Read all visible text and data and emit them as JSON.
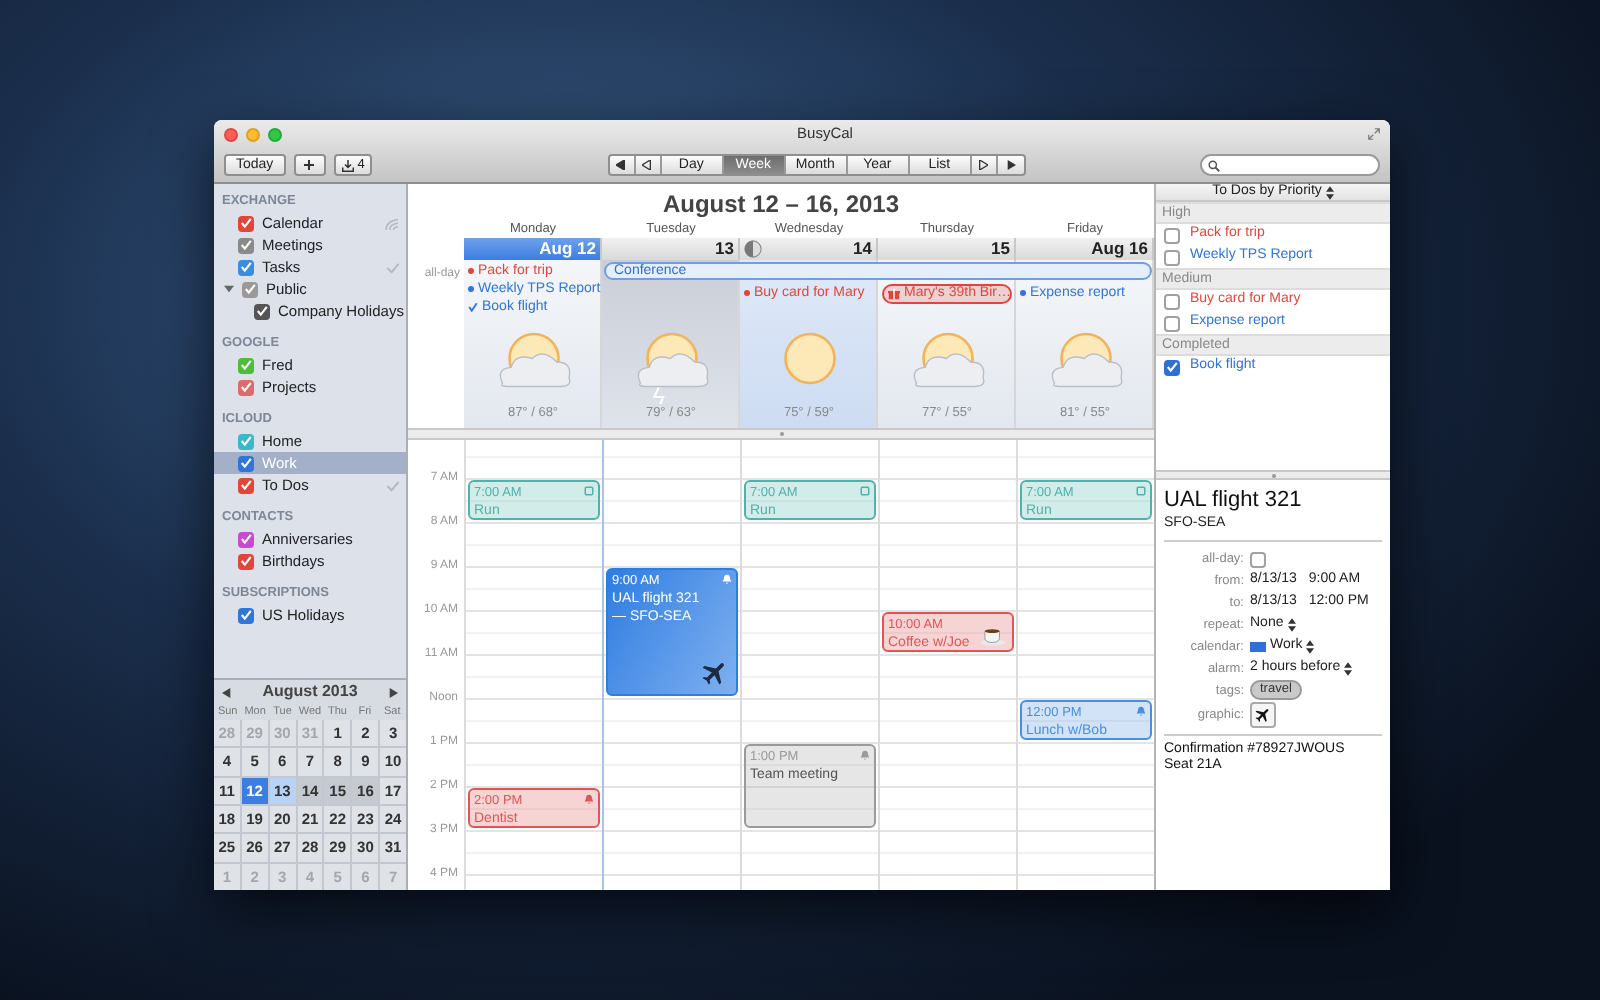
{
  "window": {
    "title": "BusyCal"
  },
  "toolbar": {
    "today": "Today",
    "downloads": "4",
    "views": [
      {
        "label": "Day",
        "selected": false
      },
      {
        "label": "Week",
        "selected": true
      },
      {
        "label": "Month",
        "selected": false
      },
      {
        "label": "Year",
        "selected": false
      },
      {
        "label": "List",
        "selected": false
      }
    ]
  },
  "sidebar": {
    "groups": [
      {
        "title": "EXCHANGE",
        "items": [
          {
            "label": "Calendar",
            "color": "#e2463a",
            "checked": true,
            "selected": false,
            "kind": "shared"
          },
          {
            "label": "Meetings",
            "color": "#8a8a8a",
            "checked": true,
            "selected": false,
            "kind": "plain"
          },
          {
            "label": "Tasks",
            "color": "#3a8ee0",
            "checked": true,
            "selected": false,
            "kind": "tasks"
          },
          {
            "label": "Public",
            "color": "#9a9a9a",
            "checked": true,
            "selected": false,
            "kind": "plain",
            "expanded": true,
            "children": [
              {
                "label": "Company Holidays",
                "color": "#555555",
                "checked": true,
                "selected": false
              }
            ]
          }
        ]
      },
      {
        "title": "GOOGLE",
        "items": [
          {
            "label": "Fred",
            "color": "#4cbc3a",
            "checked": true,
            "selected": false,
            "kind": "plain"
          },
          {
            "label": "Projects",
            "color": "#e06a6a",
            "checked": true,
            "selected": false,
            "kind": "plain"
          }
        ]
      },
      {
        "title": "ICLOUD",
        "items": [
          {
            "label": "Home",
            "color": "#3ab8c8",
            "checked": true,
            "selected": false,
            "kind": "plain"
          },
          {
            "label": "Work",
            "color": "#2f76d8",
            "checked": true,
            "selected": true,
            "kind": "plain"
          },
          {
            "label": "To Dos",
            "color": "#e2463a",
            "checked": true,
            "selected": false,
            "kind": "tasks"
          }
        ]
      },
      {
        "title": "CONTACTS",
        "items": [
          {
            "label": "Anniversaries",
            "color": "#c84ad0",
            "checked": true,
            "selected": false,
            "kind": "plain"
          },
          {
            "label": "Birthdays",
            "color": "#e2463a",
            "checked": true,
            "selected": false,
            "kind": "plain"
          }
        ]
      },
      {
        "title": "SUBSCRIPTIONS",
        "items": [
          {
            "label": "US Holidays",
            "color": "#2f76d8",
            "checked": true,
            "selected": false,
            "kind": "plain"
          }
        ]
      }
    ]
  },
  "mini_calendar": {
    "title": "August 2013",
    "weekdays": [
      "Sun",
      "Mon",
      "Tue",
      "Wed",
      "Thu",
      "Fri",
      "Sat"
    ],
    "weeks": [
      [
        {
          "day": "28",
          "kind": "outside"
        },
        {
          "day": "29",
          "kind": "outside"
        },
        {
          "day": "30",
          "kind": "outside"
        },
        {
          "day": "31",
          "kind": "outside"
        },
        {
          "day": "1",
          "kind": "normal"
        },
        {
          "day": "2",
          "kind": "normal"
        },
        {
          "day": "3",
          "kind": "normal"
        }
      ],
      [
        {
          "day": "4",
          "kind": "normal"
        },
        {
          "day": "5",
          "kind": "normal"
        },
        {
          "day": "6",
          "kind": "normal"
        },
        {
          "day": "7",
          "kind": "normal"
        },
        {
          "day": "8",
          "kind": "normal"
        },
        {
          "day": "9",
          "kind": "normal"
        },
        {
          "day": "10",
          "kind": "normal"
        }
      ],
      [
        {
          "day": "11",
          "kind": "normal"
        },
        {
          "day": "12",
          "kind": "selected"
        },
        {
          "day": "13",
          "kind": "today"
        },
        {
          "day": "14",
          "kind": "week"
        },
        {
          "day": "15",
          "kind": "week"
        },
        {
          "day": "16",
          "kind": "week"
        },
        {
          "day": "17",
          "kind": "normal"
        }
      ],
      [
        {
          "day": "18",
          "kind": "normal"
        },
        {
          "day": "19",
          "kind": "normal"
        },
        {
          "day": "20",
          "kind": "normal"
        },
        {
          "day": "21",
          "kind": "normal"
        },
        {
          "day": "22",
          "kind": "normal"
        },
        {
          "day": "23",
          "kind": "normal"
        },
        {
          "day": "24",
          "kind": "normal"
        }
      ],
      [
        {
          "day": "25",
          "kind": "normal"
        },
        {
          "day": "26",
          "kind": "normal"
        },
        {
          "day": "27",
          "kind": "normal"
        },
        {
          "day": "28",
          "kind": "normal"
        },
        {
          "day": "29",
          "kind": "normal"
        },
        {
          "day": "30",
          "kind": "normal"
        },
        {
          "day": "31",
          "kind": "normal"
        }
      ],
      [
        {
          "day": "1",
          "kind": "outside"
        },
        {
          "day": "2",
          "kind": "outside"
        },
        {
          "day": "3",
          "kind": "outside"
        },
        {
          "day": "4",
          "kind": "outside"
        },
        {
          "day": "5",
          "kind": "outside"
        },
        {
          "day": "6",
          "kind": "outside"
        },
        {
          "day": "7",
          "kind": "outside"
        }
      ]
    ]
  },
  "calendar": {
    "title": "August 12 – 16, 2013",
    "all_day_label": "all-day",
    "hours": [
      "7 AM",
      "8 AM",
      "9 AM",
      "10 AM",
      "11 AM",
      "Noon",
      "1 PM",
      "2 PM",
      "3 PM",
      "4 PM"
    ],
    "days": [
      {
        "name": "Monday",
        "date": "Aug 12",
        "selected": true,
        "moon": false,
        "weather": {
          "kind": "suncloud"
        },
        "temps": "87° / 68°",
        "items": [
          {
            "text": "Pack for trip",
            "color": "#e2463a",
            "kind": "dot"
          },
          {
            "text": "Weekly TPS Report",
            "color": "#2f76d8",
            "kind": "dot"
          },
          {
            "text": "Book flight",
            "color": "#2f76d8",
            "kind": "done"
          }
        ],
        "events": [
          {
            "time": "7:00 AM",
            "title": "Run",
            "color": "#4db3ac",
            "kind": "hour",
            "badge": {
              "kind": "square"
            },
            "selected": false
          },
          {
            "time": "2:00 PM",
            "title": "Dentist",
            "color": "#e05555",
            "kind": "hour",
            "badge": {
              "kind": "bell"
            },
            "selected": false
          }
        ]
      },
      {
        "name": "Tuesday",
        "date": "13",
        "selected": false,
        "moon": false,
        "weather": {
          "kind": "storm"
        },
        "temps": "79° / 63°",
        "banner": "Conference",
        "events": [
          {
            "time": "9:00 AM",
            "title": "UAL flight 321 — SFO-SEA",
            "color": "#2f7de1",
            "kind": "three",
            "badge": {
              "kind": "bell"
            },
            "graphic": {
              "kind": "plane"
            },
            "selected": true
          }
        ]
      },
      {
        "name": "Wednesday",
        "date": "14",
        "selected": false,
        "moon": true,
        "weather": {
          "kind": "sun"
        },
        "temps": "75° / 59°",
        "items": [
          {
            "text": "Buy card for Mary",
            "color": "#e2463a",
            "kind": "dot"
          }
        ],
        "events": [
          {
            "time": "7:00 AM",
            "title": "Run",
            "color": "#4db3ac",
            "kind": "hour",
            "badge": {
              "kind": "square"
            },
            "selected": false
          },
          {
            "time": "1:00 PM",
            "title": "Team meeting",
            "color": "#9a9a9a",
            "kind": "two",
            "badge": {
              "kind": "bell"
            },
            "selected": false
          }
        ]
      },
      {
        "name": "Thursday",
        "date": "15",
        "selected": false,
        "moon": false,
        "weather": {
          "kind": "suncloud"
        },
        "temps": "77° / 55°",
        "items": [
          {
            "text": "Mary's 39th Bir…",
            "color": "#e2463a",
            "kind": "birthday"
          }
        ],
        "events": [
          {
            "time": "10:00 AM",
            "title": "Coffee w/Joe",
            "color": "#e05555",
            "kind": "hour",
            "graphic": {
              "kind": "coffee"
            },
            "selected": false
          }
        ]
      },
      {
        "name": "Friday",
        "date": "Aug 16",
        "selected": false,
        "moon": false,
        "weather": {
          "kind": "suncloud"
        },
        "temps": "81° / 55°",
        "items": [
          {
            "text": "Expense report",
            "color": "#2f76d8",
            "kind": "dot"
          }
        ],
        "events": [
          {
            "time": "7:00 AM",
            "title": "Run",
            "color": "#4db3ac",
            "kind": "hour",
            "badge": {
              "kind": "square"
            },
            "selected": false
          },
          {
            "time": "12:00 PM",
            "title": "Lunch w/Bob",
            "color": "#4a8ee0",
            "kind": "hour",
            "badge": {
              "kind": "bell"
            },
            "selected": false
          }
        ]
      }
    ]
  },
  "todos": {
    "title": "To Dos by Priority",
    "sections": [
      {
        "title": "High",
        "items": [
          {
            "text": "Pack for trip",
            "color": "#e2463a",
            "checked": false
          },
          {
            "text": "Weekly TPS Report",
            "color": "#2f76d8",
            "checked": false
          }
        ]
      },
      {
        "title": "Medium",
        "items": [
          {
            "text": "Buy card for Mary",
            "color": "#e2463a",
            "checked": false
          },
          {
            "text": "Expense report",
            "color": "#2f76d8",
            "checked": false
          }
        ]
      },
      {
        "title": "Completed",
        "items": [
          {
            "text": "Book flight",
            "color": "#2f76d8",
            "checked": true
          }
        ]
      }
    ]
  },
  "details": {
    "title": "UAL flight 321",
    "subtitle": "SFO-SEA",
    "fields": [
      {
        "label": "all-day:",
        "kind": "checkbox",
        "checked": false
      },
      {
        "label": "from:",
        "kind": "datetime",
        "date": "8/13/13",
        "time": "9:00 AM"
      },
      {
        "label": "to:",
        "kind": "datetime",
        "date": "8/13/13",
        "time": "12:00 PM"
      },
      {
        "label": "repeat:",
        "kind": "popup",
        "value": "None"
      },
      {
        "label": "calendar:",
        "kind": "calendar",
        "value": "Work",
        "color": "#2f6fd6"
      },
      {
        "label": "alarm:",
        "kind": "popup",
        "value": "2 hours before"
      },
      {
        "label": "tags:",
        "kind": "tag",
        "value": "travel"
      },
      {
        "label": "graphic:",
        "kind": "graphic"
      }
    ],
    "notes": [
      "Confirmation #78927JWOUS",
      "Seat 21A"
    ]
  }
}
